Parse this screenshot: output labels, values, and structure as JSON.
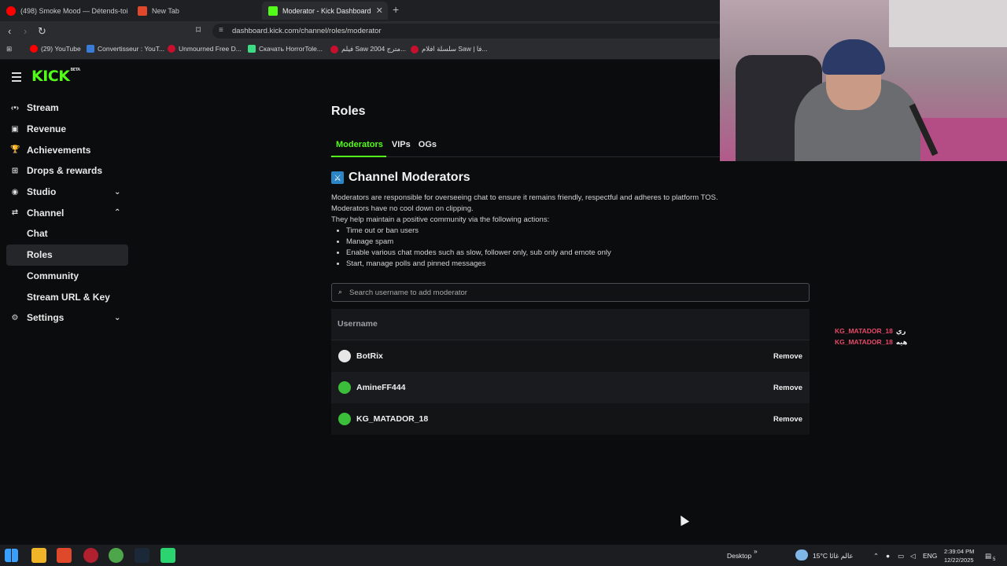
{
  "browser": {
    "tabs": [
      {
        "title": "(498) Smoke Mood — Détends-toi | ",
        "active": false,
        "favicon_color": "#ff0000"
      },
      {
        "title": "New Tab",
        "active": false,
        "favicon_color": "#e0482b"
      },
      {
        "title": "Moderator - Kick Dashboard",
        "active": true,
        "favicon_color": "#53fc18"
      }
    ],
    "new_tab_symbol": "+",
    "url": "dashboard.kick.com/channel/roles/moderator",
    "bookmarks": [
      {
        "label": "(29) YouTube",
        "color": "#ff0000"
      },
      {
        "label": "Convertisseur : YouT...",
        "color": "#3a7bd5"
      },
      {
        "label": "Unmourned Free D...",
        "color": "#c8102e"
      },
      {
        "label": "Скачать HorrorTole...",
        "color": "#3ddc84"
      },
      {
        "label": "فيلم Saw 2004 مترج...",
        "color": "#c8102e"
      },
      {
        "label": "سلسلة افلام Saw | فا...",
        "color": "#c8102e"
      }
    ]
  },
  "app": {
    "logo": "KICK",
    "logo_badge": "BETA",
    "accent": "#53fc18"
  },
  "sidebar": {
    "items": [
      {
        "label": "Stream",
        "icon": "stream-icon",
        "glyph": "‹•›"
      },
      {
        "label": "Revenue",
        "icon": "revenue-icon",
        "glyph": "▣"
      },
      {
        "label": "Achievements",
        "icon": "trophy-icon",
        "glyph": "🏆"
      },
      {
        "label": "Drops & rewards",
        "icon": "drops-icon",
        "glyph": "⊞"
      },
      {
        "label": "Studio",
        "icon": "studio-icon",
        "glyph": "◉",
        "chevron": "down"
      },
      {
        "label": "Channel",
        "icon": "channel-icon",
        "glyph": "⇄",
        "chevron": "up"
      }
    ],
    "sub_items": [
      {
        "label": "Chat",
        "selected": false
      },
      {
        "label": "Roles",
        "selected": true
      },
      {
        "label": "Community",
        "selected": false
      },
      {
        "label": "Stream URL & Key",
        "selected": false
      }
    ],
    "settings": {
      "label": "Settings",
      "icon": "gear-icon",
      "glyph": "⚙",
      "chevron": "down"
    }
  },
  "main": {
    "title": "Roles",
    "tabs": [
      "Moderators",
      "VIPs",
      "OGs"
    ],
    "section_title": "Channel Moderators",
    "description": [
      "Moderators are responsible for overseeing chat to ensure it remains friendly, respectful and adheres to platform TOS.",
      "Moderators have no cool down on clipping.",
      "They help maintain a positive community via the following actions:"
    ],
    "actions": [
      "Time out or ban users",
      "Manage spam",
      "Enable various chat modes such as slow, follower only, sub only and emote only",
      "Start, manage polls and pinned messages"
    ],
    "search_placeholder": "Search username to add moderator",
    "table": {
      "header": "Username",
      "remove_label": "Remove",
      "rows": [
        {
          "username": "BotRix",
          "avatar_color": "#e6e6e6"
        },
        {
          "username": "AmineFF444",
          "avatar_color": "#3bbf3b"
        },
        {
          "username": "KG_MATADOR_18",
          "avatar_color": "#3bbf3b"
        }
      ]
    }
  },
  "chat_overlay": [
    {
      "user": "KG_MATADOR_18",
      "message": "ري"
    },
    {
      "user": "KG_MATADOR_18",
      "message": "هيه"
    }
  ],
  "taskbar": {
    "desktop_label": "Desktop",
    "chevron": "»",
    "weather": "15°C عالم غائا",
    "language": "ENG",
    "time": "2:39:04 PM",
    "date": "12/22/2025",
    "notification_count": "5"
  }
}
